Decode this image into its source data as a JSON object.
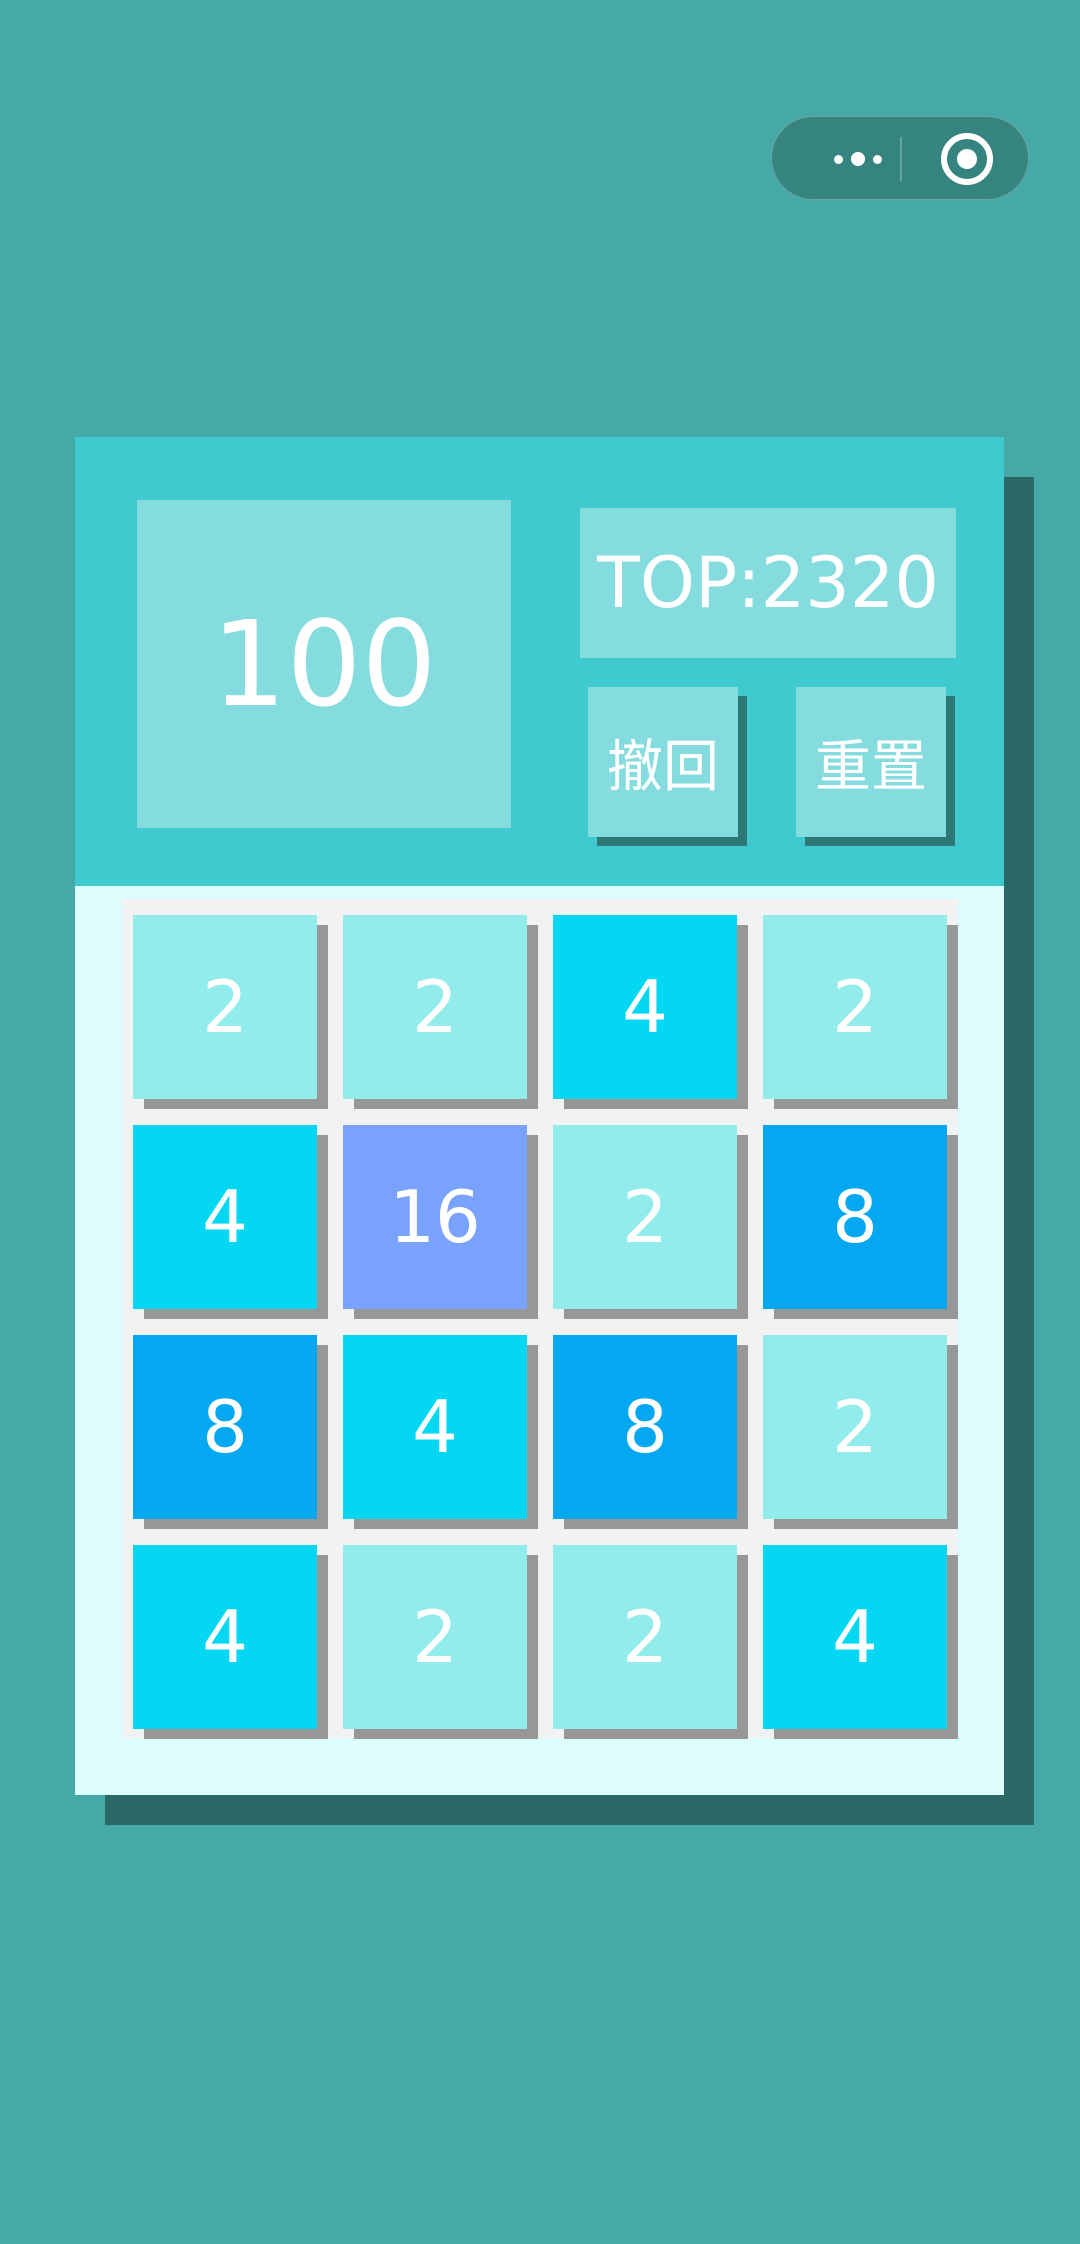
{
  "capsule": {
    "more_icon": "more-dots-icon",
    "close_icon": "target-circle-icon"
  },
  "header": {
    "score": "100",
    "best": "TOP:2320",
    "undo_label": "撤回",
    "reset_label": "重置"
  },
  "colors": {
    "background": "#46a9a8",
    "header": "#3fcad0",
    "score_box": "#84dcdf",
    "board_bg": "#ddfefd",
    "grid_bg": "#f2f2f2",
    "tile_2": "#92ecec",
    "tile_4": "#04d7f2",
    "tile_8": "#03a8f1",
    "tile_16": "#78a2fb"
  },
  "board": [
    [
      "2",
      "2",
      "4",
      "2"
    ],
    [
      "4",
      "16",
      "2",
      "8"
    ],
    [
      "8",
      "4",
      "8",
      "2"
    ],
    [
      "4",
      "2",
      "2",
      "4"
    ]
  ]
}
